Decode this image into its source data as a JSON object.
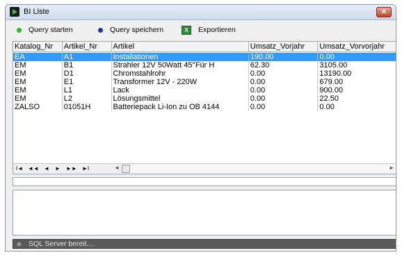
{
  "window": {
    "title": "BI Liste",
    "close_label": "✕"
  },
  "toolbar": {
    "query_start_label": "Query starten",
    "query_save_label": "Query speichern",
    "export_label": "Exportieren",
    "colors": {
      "start_dot": "#2fb52f",
      "save_dot": "#1c2fb0",
      "excel": "#2f8b3a"
    }
  },
  "grid": {
    "columns": [
      "Katalog_Nr",
      "Artikel_Nr",
      "Artikel",
      "Umsatz_Vorjahr",
      "Umsatz_Vorvorjahr"
    ],
    "rows": [
      [
        "EA",
        "A1",
        "Installationen",
        "190.00",
        "0.00"
      ],
      [
        "EM",
        "B1",
        "Strahler 12V 50Watt 45°Für H",
        "62.30",
        "3105.00"
      ],
      [
        "EM",
        "D1",
        "Chromstahlrohr",
        "0.00",
        "13190.00"
      ],
      [
        "EM",
        "E1",
        "Transformer 12V - 220W",
        "0.00",
        "679.00"
      ],
      [
        "EM",
        "L1",
        "Lack",
        "0.00",
        "900.00"
      ],
      [
        "EM",
        "L2",
        "Lösungsmittel",
        "0.00",
        "22.50"
      ],
      [
        "ZALSO",
        "01051H",
        "Batteriepack Li-Ion zu OB 4144",
        "0.00",
        "0.00"
      ]
    ],
    "selected_row": 0,
    "nav": {
      "first": "I◄",
      "prev_page": "◄◄",
      "prev": "◄",
      "next": "►",
      "next_page": "►►",
      "last": "►I"
    },
    "scroll_left": "◄",
    "scroll_right": "►"
  },
  "status": {
    "text": "SQL Server bereit...."
  }
}
